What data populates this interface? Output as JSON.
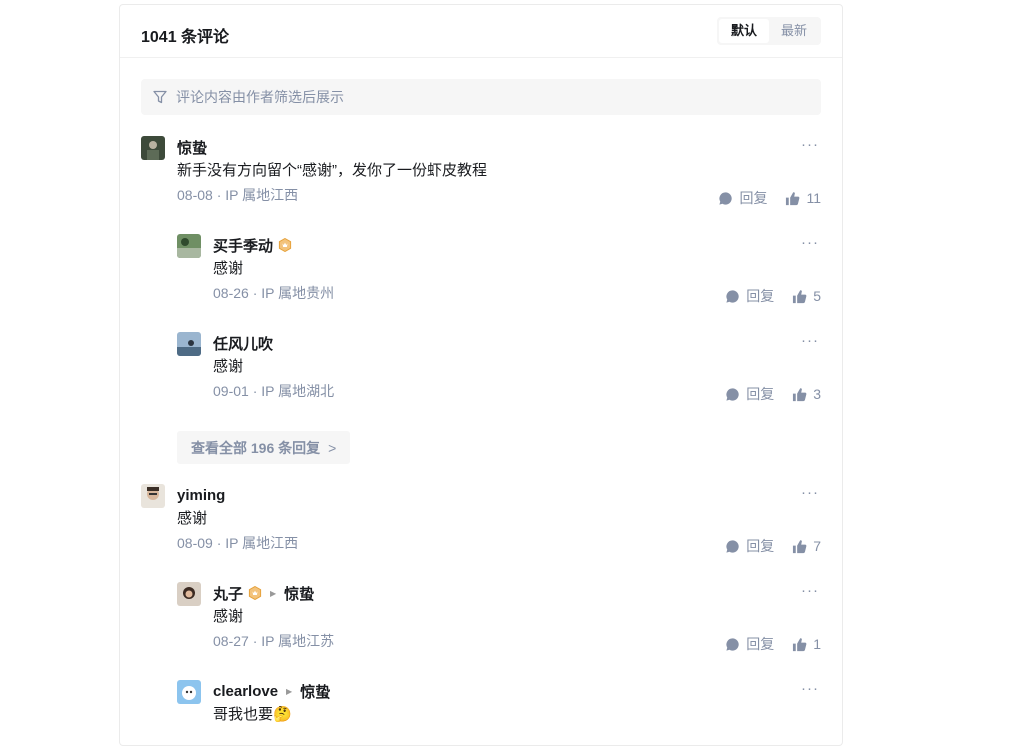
{
  "header": {
    "count": "1041 条评论",
    "sort_default": "默认",
    "sort_latest": "最新"
  },
  "filter": {
    "text": "评论内容由作者筛选后展示"
  },
  "reply_label": "回复",
  "more_label": "···",
  "comments": [
    {
      "name": "惊蛰",
      "text": "新手没有方向留个“感谢”，发你了一份虾皮教程",
      "meta": "08-08 · IP 属地江西",
      "likes": "11",
      "replies": [
        {
          "name": "买手季动",
          "text": "感谢",
          "meta": "08-26 · IP 属地贵州",
          "likes": "5"
        },
        {
          "name": "任风儿吹",
          "text": "感谢",
          "meta": "09-01 · IP 属地湖北",
          "likes": "3"
        }
      ],
      "view_all": "查看全部 196 条回复"
    },
    {
      "name": "yiming",
      "text": "感谢",
      "meta": "08-09 · IP 属地江西",
      "likes": "7",
      "replies": [
        {
          "name": "丸子",
          "reply_to": "惊蛰",
          "text": "感谢",
          "meta": "08-27 · IP 属地江苏",
          "likes": "1"
        },
        {
          "name": "clearlove",
          "reply_to": "惊蛰",
          "text": "哥我也要",
          "text_emoji": "🤔"
        }
      ]
    }
  ],
  "colors": {
    "muted": "#8590a6",
    "text": "#191b1f",
    "badge": "#e6a23c",
    "filter_bg": "#f6f6f6"
  }
}
